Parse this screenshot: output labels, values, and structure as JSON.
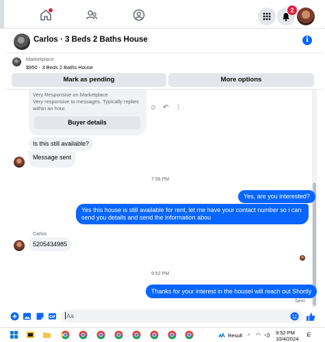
{
  "topnav": {
    "icons": [
      "home-icon",
      "groups-icon",
      "profile-icon",
      "menu-grid-icon",
      "notifications-icon",
      "account-avatar"
    ],
    "notification_count": "2",
    "accent": "#0866ff",
    "alert": "#e41e3f"
  },
  "chat": {
    "title": "Carlos · 3 Beds 2 Baths House"
  },
  "marketplace": {
    "label": "Marketplace",
    "listing": "$950 - 3 Beds 2 Baths House"
  },
  "actions": {
    "mark_pending": "Mark as pending",
    "more_options": "More options"
  },
  "card": {
    "line1": "Very Responsive on Marketplace",
    "line2": "Very responsive to messages. Typically replies within an hour.",
    "buyer_details": "Buyer details"
  },
  "messages": {
    "m1": "Is this still available?",
    "m2": "Message sent",
    "time1": "7:58 PM",
    "m3": "Yes, are you interested?",
    "m4_line1": "Yes this house is still available for rent, let me have your contact number so i can",
    "m4_line2": "send you details and send the information abou",
    "sender": "Carlos",
    "m5": "5205434985",
    "time2": "9:52 PM",
    "m6": "Thanks for your interest in the houseI will reach out Shortly",
    "sent": "Sent"
  },
  "composer": {
    "placeholder": "Aa"
  },
  "taskbar": {
    "search_label": "Result",
    "time": "9:52 PM",
    "date": "10/4/2024"
  }
}
